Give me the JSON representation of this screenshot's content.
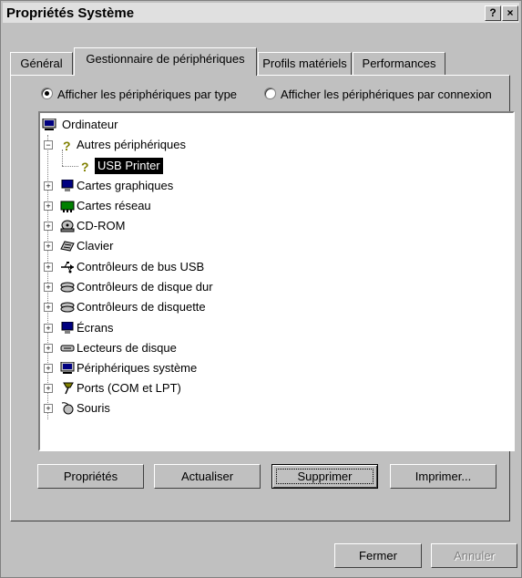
{
  "window": {
    "title": "Propriétés Système",
    "help_glyph": "?",
    "close_glyph": "×"
  },
  "tabs": [
    {
      "label": "Général"
    },
    {
      "label": "Gestionnaire de périphériques"
    },
    {
      "label": "Profils matériels"
    },
    {
      "label": "Performances"
    }
  ],
  "view_options": {
    "by_type_label": "Afficher les périphériques par type",
    "by_connection_label": "Afficher les périphériques par connexion",
    "selected": "by_type"
  },
  "tree": {
    "root": "Ordinateur",
    "items": [
      {
        "label": "Autres périphériques",
        "expander": "−",
        "icon": "unknown-device-icon"
      },
      {
        "label": "USB Printer",
        "selected": true,
        "icon": "unknown-device-icon"
      },
      {
        "label": "Cartes graphiques",
        "expander": "+",
        "icon": "monitor-icon"
      },
      {
        "label": "Cartes réseau",
        "expander": "+",
        "icon": "network-card-icon"
      },
      {
        "label": "CD-ROM",
        "expander": "+",
        "icon": "cdrom-icon"
      },
      {
        "label": "Clavier",
        "expander": "+",
        "icon": "keyboard-icon"
      },
      {
        "label": "Contrôleurs de bus USB",
        "expander": "+",
        "icon": "usb-icon"
      },
      {
        "label": "Contrôleurs de disque dur",
        "expander": "+",
        "icon": "disk-controller-icon"
      },
      {
        "label": "Contrôleurs de disquette",
        "expander": "+",
        "icon": "floppy-controller-icon"
      },
      {
        "label": "Écrans",
        "expander": "+",
        "icon": "monitor-icon"
      },
      {
        "label": "Lecteurs de disque",
        "expander": "+",
        "icon": "disk-drive-icon"
      },
      {
        "label": "Périphériques système",
        "expander": "+",
        "icon": "system-device-icon"
      },
      {
        "label": "Ports (COM et LPT)",
        "expander": "+",
        "icon": "port-icon"
      },
      {
        "label": "Souris",
        "expander": "+",
        "icon": "mouse-icon"
      }
    ]
  },
  "buttons": {
    "properties": "Propriétés",
    "refresh": "Actualiser",
    "remove": "Supprimer",
    "print": "Imprimer...",
    "close": "Fermer",
    "cancel": "Annuler"
  },
  "colors": {
    "face": "#c0c0c0",
    "selection": "#000000",
    "disabled_text": "#808080"
  }
}
